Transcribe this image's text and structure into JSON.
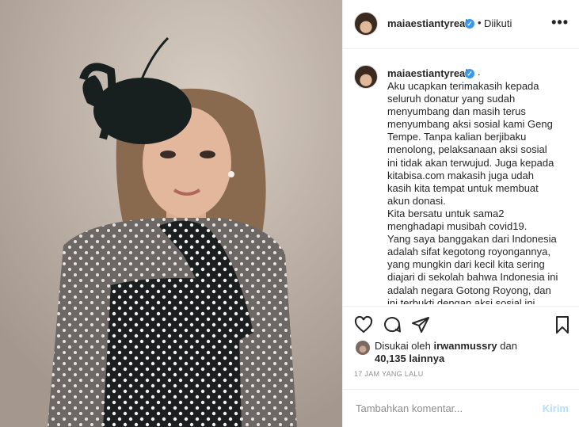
{
  "post": {
    "username": "maiaestiantyreal",
    "follow_status": "Diikuti",
    "separator": "•",
    "more_label": "•••"
  },
  "caption": {
    "username": "maiaestiantyreal",
    "trailing": ".",
    "text": "Aku ucapkan terimakasih kepada seluruh donatur yang sudah menyumbang dan masih terus menyumbang aksi sosial kami Geng Tempe. Tanpa kalian berjibaku menolong, pelaksanaan aksi sosial ini tidak akan terwujud. Juga kepada kitabisa.com makasih juga udah kasih kita tempat untuk membuat akun donasi.\nKita bersatu untuk sama2 menghadapi musibah covid19.\nYang saya banggakan dari Indonesia adalah sifat kegotong royongannya, yang mungkin dari kecil kita sering diajari di sekolah bahwa Indonesia ini adalah negara Gotong Royong, dan ini terbukti dengan aksi sosial ini."
  },
  "likes": {
    "prefix": "Disukai oleh",
    "user": "irwanmussry",
    "connector": "dan",
    "count": "40,135 lainnya"
  },
  "timestamp": "17 JAM YANG LALU",
  "comment": {
    "placeholder": "Tambahkan komentar...",
    "post_label": "Kirim"
  },
  "icons": {
    "like": "heart-icon",
    "comment": "comment-icon",
    "share": "paper-plane-icon",
    "save": "bookmark-icon",
    "verified": "verified-badge-icon",
    "more": "more-options-icon"
  },
  "colors": {
    "verified": "#3897f0",
    "post_button": "#b2dffc",
    "muted": "#8e8e8e",
    "text": "#262626"
  }
}
